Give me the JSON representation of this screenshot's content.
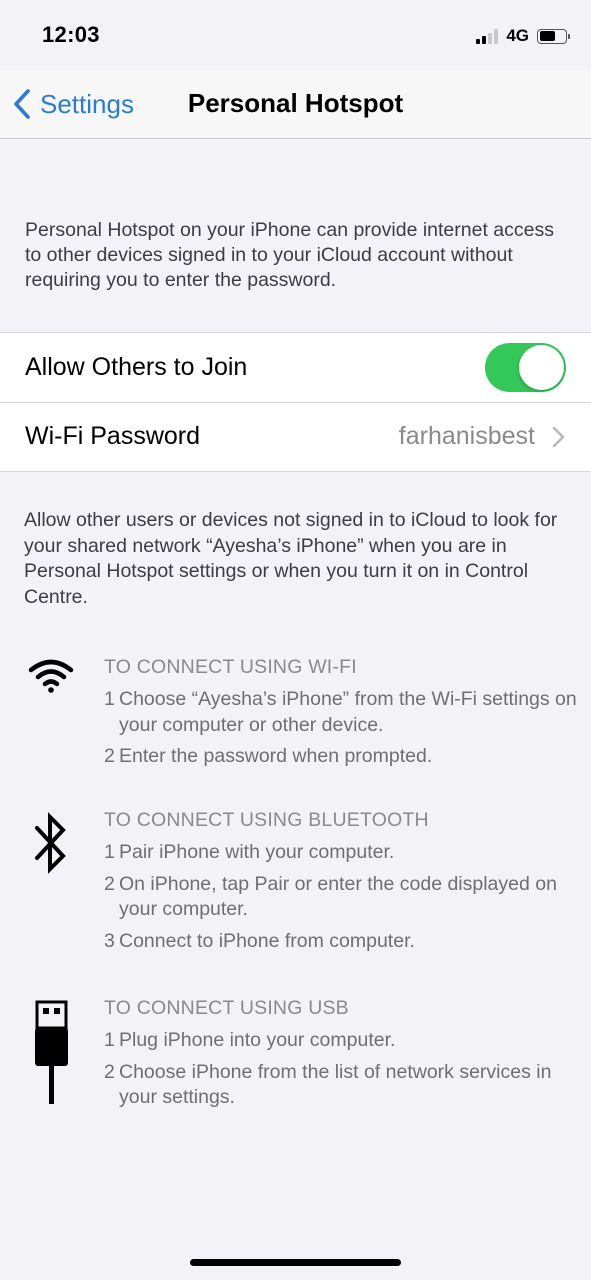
{
  "status": {
    "time": "12:03",
    "network": "4G"
  },
  "nav": {
    "back_label": "Settings",
    "title": "Personal Hotspot"
  },
  "intro_text": "Personal Hotspot on your iPhone can provide internet access to other devices signed in to your iCloud account without requiring you to enter the password.",
  "settings": {
    "allow_label": "Allow Others to Join",
    "allow_enabled": true,
    "wifi_password_label": "Wi-Fi Password",
    "wifi_password_value": "farhanisbest"
  },
  "note_text": "Allow other users or devices not signed in to iCloud to look for your shared network “Ayesha’s iPhone” when you are in Personal Hotspot settings or when you turn it on in Control Centre.",
  "sections": [
    {
      "icon": "wifi-icon",
      "heading": "TO CONNECT USING WI-FI",
      "steps": [
        {
          "num": "1",
          "text": "Choose “Ayesha’s iPhone” from the Wi-Fi settings on your computer or other device."
        },
        {
          "num": "2",
          "text": "Enter the password when prompted."
        }
      ]
    },
    {
      "icon": "bluetooth-icon",
      "heading": "TO CONNECT USING BLUETOOTH",
      "steps": [
        {
          "num": "1",
          "text": "Pair iPhone with your computer."
        },
        {
          "num": "2",
          "text": "On iPhone, tap Pair or enter the code displayed on your computer."
        },
        {
          "num": "3",
          "text": "Connect to iPhone from computer."
        }
      ]
    },
    {
      "icon": "usb-icon",
      "heading": "TO CONNECT USING USB",
      "steps": [
        {
          "num": "1",
          "text": "Plug iPhone into your computer."
        },
        {
          "num": "2",
          "text": "Choose iPhone from the list of network services in your settings."
        }
      ]
    }
  ],
  "colors": {
    "toggle_on": "#34c759",
    "link_blue": "#2a7bd8",
    "background": "#f2f2f7"
  }
}
